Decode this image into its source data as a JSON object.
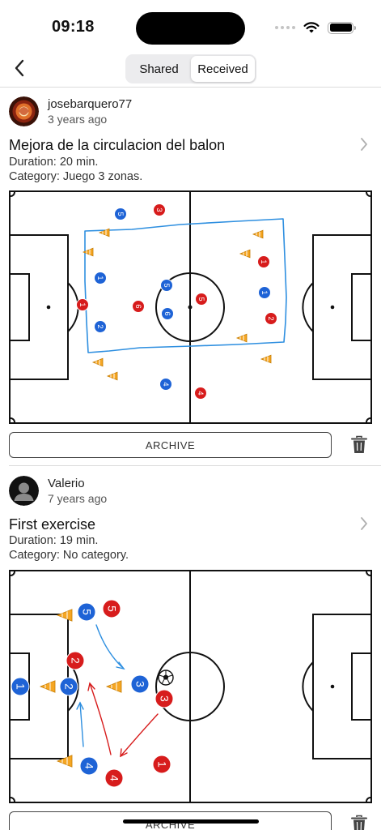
{
  "status_bar": {
    "time": "09:18",
    "battery_level": 1.0
  },
  "nav": {
    "back_icon": "chevron-left-icon",
    "tabs": [
      {
        "label": "Shared",
        "active": false
      },
      {
        "label": "Received",
        "active": true
      }
    ]
  },
  "exercises": [
    {
      "author": "josebarquero77",
      "time_ago": "3 years ago",
      "avatar_icon": "user-photo-avatar",
      "title": "Mejora de la circulacion del balon",
      "duration": "Duration: 20 min.",
      "category": "Category: Juego 3 zonas.",
      "archive_label": "ARCHIVE",
      "players": [
        {
          "team": "blue",
          "number": "5"
        },
        {
          "team": "blue",
          "number": "1"
        },
        {
          "team": "blue",
          "number": "5"
        },
        {
          "team": "blue",
          "number": "6"
        },
        {
          "team": "blue",
          "number": "2"
        },
        {
          "team": "blue",
          "number": "4"
        },
        {
          "team": "blue",
          "number": "1"
        },
        {
          "team": "red",
          "number": "3"
        },
        {
          "team": "red",
          "number": "1"
        },
        {
          "team": "red",
          "number": "6"
        },
        {
          "team": "red",
          "number": "5"
        },
        {
          "team": "red",
          "number": "1"
        },
        {
          "team": "red",
          "number": "2"
        },
        {
          "team": "red",
          "number": "4"
        }
      ]
    },
    {
      "author": "Valerio",
      "time_ago": "7 years ago",
      "avatar_icon": "default-person-avatar",
      "title": "First exercise",
      "duration": "Duration: 19 min.",
      "category": "Category: No category.",
      "archive_label": "ARCHIVE",
      "players": [
        {
          "team": "blue",
          "number": "5"
        },
        {
          "team": "blue",
          "number": "1"
        },
        {
          "team": "blue",
          "number": "2"
        },
        {
          "team": "blue",
          "number": "3"
        },
        {
          "team": "blue",
          "number": "4"
        },
        {
          "team": "red",
          "number": "5"
        },
        {
          "team": "red",
          "number": "2"
        },
        {
          "team": "red",
          "number": "3"
        },
        {
          "team": "red",
          "number": "4"
        },
        {
          "team": "red",
          "number": "1"
        }
      ]
    }
  ],
  "colors": {
    "blue_player": "#1e63d6",
    "red_player": "#d71c1c",
    "cone": "#f5a623",
    "zone_line": "#2e8fe0",
    "accent": "#007aff"
  }
}
